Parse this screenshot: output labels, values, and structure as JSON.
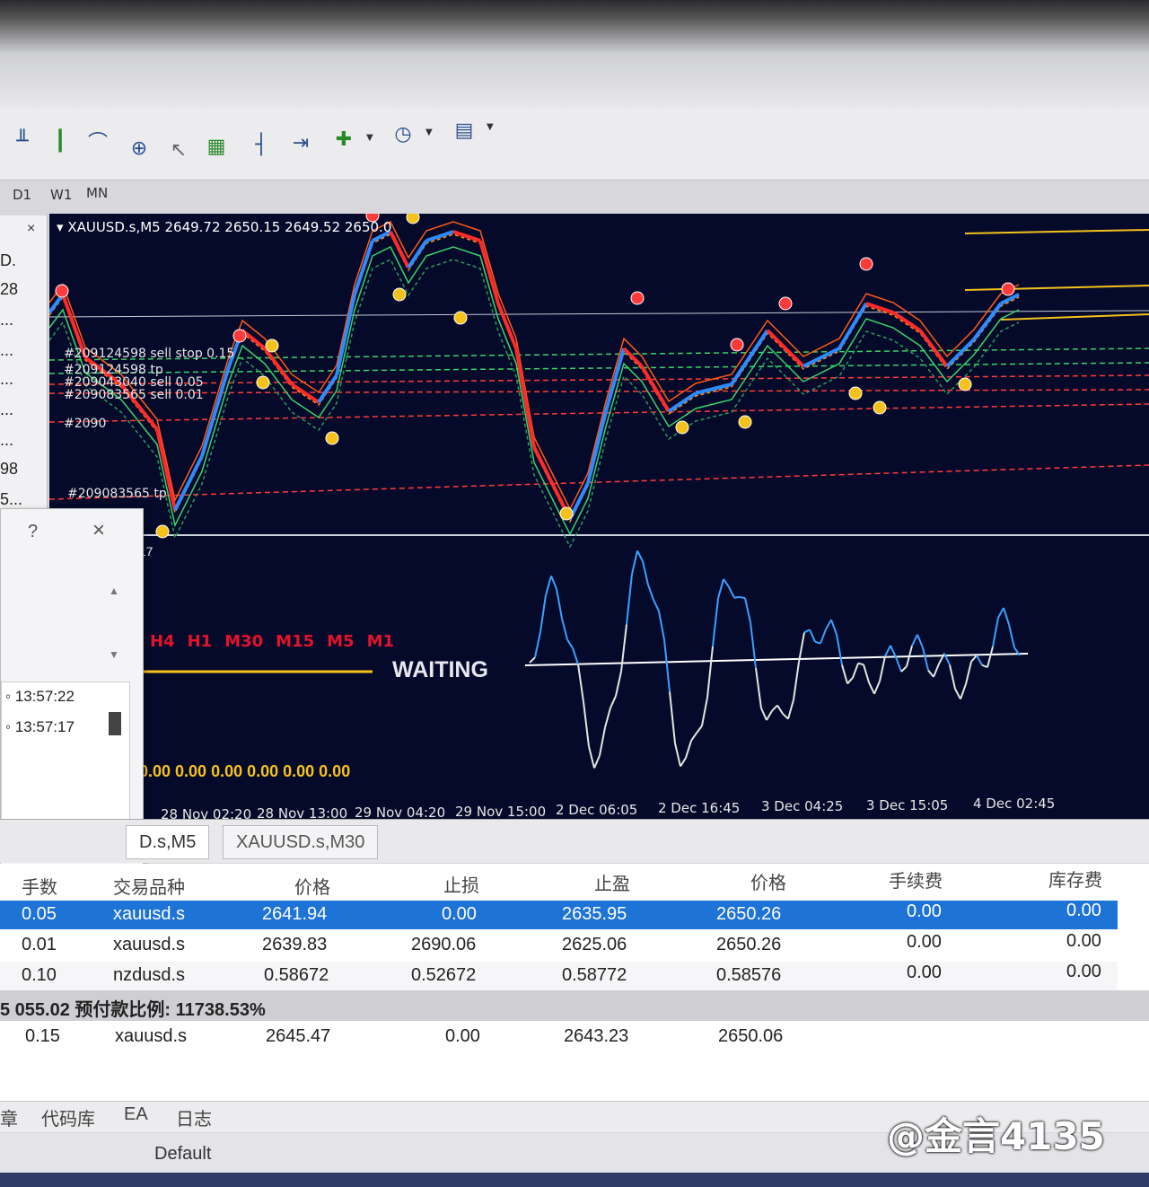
{
  "toolbar": {
    "timeframes": [
      "D1",
      "W1",
      "MN"
    ],
    "icons": [
      "bar-chart-icon",
      "candlestick-icon",
      "line-chart-icon",
      "zoom-in-icon",
      "cursor-icon",
      "tile-windows-icon",
      "period-icon",
      "shift-icon",
      "add-indicator-icon",
      "clock-icon",
      "template-icon"
    ]
  },
  "left_panel": {
    "rows": [
      "D.",
      "28",
      "...",
      "...",
      "...",
      "...",
      "...",
      "98",
      "5..."
    ],
    "close": "×"
  },
  "chart": {
    "symbol_header": "XAUUSD.s,M5  2649.72 2650.15 2649.52 2650.0",
    "order_labels": [
      "#209124598 sell stop 0.15",
      "#209124598 tp",
      "#209043040 sell 0.05",
      "#209083565 sell 0.01",
      "#2090",
      "#209083565 tp"
    ],
    "sub_value": ".17",
    "tf_tags": [
      "H4",
      "H1",
      "M30",
      "M15",
      "M5",
      "M1"
    ],
    "waiting": "WAITING",
    "zeros": "0.00 0.00 0.00 0.00 0.00 0.00",
    "time_labels": [
      "28 Nov 02:20",
      "28 Nov 13:00",
      "29 Nov 04:20",
      "29 Nov 15:00",
      "2 Dec 06:05",
      "2 Dec 16:45",
      "3 Dec 04:25",
      "3 Dec 15:05",
      "4 Dec 02:45"
    ],
    "colors": {
      "background": "#050a2a",
      "bull": "#2e8bff",
      "bear": "#ff2a2a",
      "oscillator": "#3aa0ff",
      "baseline": "#ffffff",
      "zeros": "#f5c21c"
    }
  },
  "dialog": {
    "question": "?",
    "close": "×",
    "times": [
      "13:57:22",
      "13:57:17"
    ]
  },
  "tabs": [
    "D.s,M5",
    "XAUUSD.s,M30"
  ],
  "table": {
    "headers": [
      "手数",
      "交易品种",
      "价格",
      "止损",
      "止盈",
      "价格",
      "手续费",
      "库存费"
    ],
    "rows": [
      [
        "0.05",
        "xauusd.s",
        "2641.94",
        "0.00",
        "2635.95",
        "2650.26",
        "0.00",
        "0.00"
      ],
      [
        "0.01",
        "xauusd.s",
        "2639.83",
        "2690.06",
        "2625.06",
        "2650.26",
        "0.00",
        "0.00"
      ],
      [
        "0.10",
        "nzdusd.s",
        "0.58672",
        "0.52672",
        "0.58772",
        "0.58576",
        "0.00",
        "0.00"
      ]
    ],
    "summary": "5 055.02  预付款比例: 11738.53%",
    "pending": [
      "0.15",
      "xauusd.s",
      "2645.47",
      "0.00",
      "2643.23",
      "2650.06"
    ]
  },
  "bottom_tabs": [
    "章",
    "代码库",
    "EA",
    "日志"
  ],
  "status": {
    "profile": "Default"
  },
  "watermark": "@金言4135"
}
